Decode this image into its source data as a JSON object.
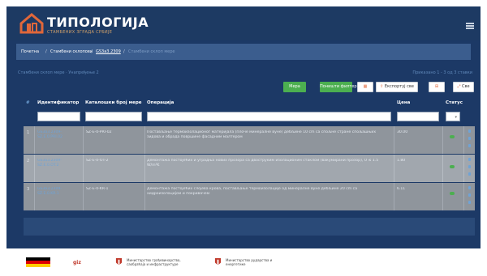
{
  "brand": {
    "title": "ТИПОЛОГИЈА",
    "subtitle": "СТАМБЕНИХ ЗГРАДА СРБИЈЕ"
  },
  "breadcrumb": {
    "home": "Почетна",
    "level1": "Стамбени склопови",
    "level2": "GS3a3.2309",
    "level3": "Стамбени склоп мере"
  },
  "info": {
    "left": "Стамбени склоп мере · Унапређење 2",
    "right": "Приказано 1 - 3 од 3 ставки"
  },
  "toolbar": {
    "btn1": "Мера",
    "btn2": "Поништи филтер",
    "btn3": "▦",
    "btn4": "Експортуј све",
    "btn5": "⊞",
    "btn6": "Све"
  },
  "table": {
    "headers": {
      "identifier": "Идентификатор",
      "catalog": "Каталошки број мере",
      "operation": "Операција",
      "price": "Цена",
      "status": "Статус"
    },
    "rows": [
      {
        "num": "1",
        "identifier": "GS3a3.2309-SZ.E.0.PRI.02",
        "catalog": "SZ-E-0-PRI-02",
        "operation": "Постављање термоизолационог материјала (плоче минералне вуне) дебљине 10 cm са спољне стране спољашњих зидова и обрада површине фасадним малтером",
        "price": "30.00",
        "status": "active"
      },
      {
        "num": "2",
        "identifier": "GS3a3.2309-SZ.E.0.OT.2",
        "catalog": "SZ-E-0-OT-2",
        "operation": "Демонтажа постојећих и уградња нових прозора са двоструким изолационим стаклом (вакумирани прозор), U ≤ 1.5 W/m²K",
        "price": "1.80",
        "status": "active"
      },
      {
        "num": "3",
        "identifier": "GS3a3.2309-SZ.E.0.KR.1",
        "catalog": "SZ-E-0-KR-1",
        "operation": "Демонтажа постојећих слојева крова, постављање термоизолације од минералне вуне дебљине 20 cm са хидроизолацијом и покривачем",
        "price": "6.11",
        "status": "active"
      }
    ]
  },
  "partners": {
    "p1": "Министарство грађевинарства, саобраћаја и инфраструктуре",
    "p2": "Министарство рударства и енергетике"
  },
  "colors": {
    "header": "#1d3a63",
    "content": "#1c3966",
    "row": "#8f959c",
    "accent": "#4caf50"
  }
}
